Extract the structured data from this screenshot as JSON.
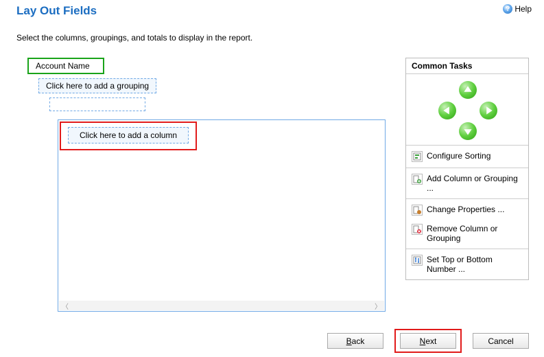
{
  "header": {
    "title": "Lay Out Fields",
    "help_label": "Help"
  },
  "instruction": "Select the columns, groupings, and totals to display in the report.",
  "layout": {
    "account_label": "Account Name",
    "add_grouping_label": "Click here to add a grouping",
    "add_column_label": "Click here to add a column"
  },
  "tasks": {
    "header": "Common Tasks",
    "configure_sorting": "Configure Sorting",
    "add_column_grouping": "Add Column or Grouping ...",
    "change_properties": "Change Properties ...",
    "remove_column_grouping": "Remove Column or Grouping",
    "set_top_bottom": "Set Top or Bottom Number ..."
  },
  "buttons": {
    "back": "Back",
    "next": "Next",
    "cancel": "Cancel"
  }
}
